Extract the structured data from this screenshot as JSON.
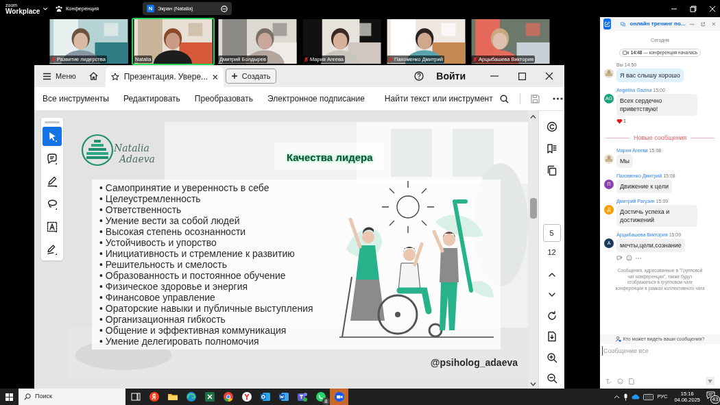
{
  "app_bar": {
    "brand": [
      "zoom",
      "Workplace"
    ],
    "meeting_label": "Конференция",
    "share_pill": {
      "badge": "N",
      "label": "Экран (Natalia)"
    }
  },
  "videos": [
    {
      "name": "Развитие лидерства",
      "muted": true,
      "selected": false
    },
    {
      "name": "Natalia",
      "muted": false,
      "selected": true
    },
    {
      "name": "Дмитрий Болдырев",
      "muted": false,
      "selected": false
    },
    {
      "name": "Мария Агеева",
      "muted": true,
      "selected": false
    },
    {
      "name": "Пахоменко Дмитрий",
      "muted": true,
      "selected": false
    },
    {
      "name": "Арцыбашева Виктория",
      "muted": true,
      "selected": false
    }
  ],
  "viewer": {
    "menu": "Меню",
    "tab_title": "Презентация. Увере...",
    "create": "Создать",
    "sign_in": "Войти",
    "tools": [
      "Все инструменты",
      "Редактировать",
      "Преобразовать",
      "Электронное подписание"
    ],
    "search": "Найти текст или инструмент",
    "left_tools": [
      {
        "kind": "select",
        "selected": true
      },
      {
        "kind": "comment",
        "selected": false
      },
      {
        "kind": "draw",
        "selected": false
      },
      {
        "kind": "lasso",
        "selected": false
      },
      {
        "kind": "textbox",
        "selected": false
      },
      {
        "kind": "sign",
        "selected": false
      }
    ],
    "page": {
      "current": "5",
      "total": "12"
    }
  },
  "slide": {
    "logo": [
      "Natalia",
      "Adaeva"
    ],
    "title": "Качества лидера",
    "items": [
      "• Самопринятие и уверенность в себе",
      "• Целеустремленность",
      "• Ответственность",
      "• Умение вести за собой людей",
      "• Высокая степень осознанности",
      "• Устойчивость и упорство",
      "• Инициативность и стремление к развитию",
      "• Решительность и смелость",
      "• Образованность и постоянное обучение",
      "• Физическое здоровье и энергия",
      "• Финансовое управление",
      "• Ораторские навыки и публичные выступления",
      "• Организационная гибкость",
      "• Общение и эффективная коммуникация",
      "• Умение делегировать полномочия"
    ],
    "handle": "@psiholog_adaeva"
  },
  "chat": {
    "title": "онлайн тренинг по...",
    "day": "Сегодня",
    "event": {
      "time": "14:48",
      "text": "— конференция началась"
    },
    "messages": [
      {
        "kind": "own",
        "header": "Вы 14:50",
        "text": "Я вас слышу хорошо",
        "hovered": false
      },
      {
        "kind": "message",
        "sender": "Angelina Gazina",
        "time": "15:00",
        "initials": "AG",
        "color": "#16a07e",
        "text": "Всех сердечно приветствую!",
        "reaction_count": "1",
        "hovered": false
      },
      {
        "kind": "divider",
        "text": "Новые сообщения"
      },
      {
        "kind": "message",
        "sender": "Мария Агеева",
        "time": "15:08",
        "text": "Мы",
        "hovered": false
      },
      {
        "kind": "message",
        "sender": "Пахоменко Дмитрий",
        "time": "15:08",
        "initials": "П",
        "color": "#8e3fb0",
        "text": "Движение к цели",
        "hovered": false
      },
      {
        "kind": "message",
        "sender": "Дмитрий Рагузин",
        "time": "15:09",
        "initials": "Д",
        "color": "#f4a000",
        "text": "Достичь успеха и достижений",
        "hovered": false
      },
      {
        "kind": "message",
        "sender": "Арцыбашева Виктория",
        "time": "15:09",
        "initials": "A",
        "color": "#1c3a58",
        "text": "мечты,цели,сознание",
        "hovered": true
      }
    ],
    "notice": "Сообщения, адресованные в \"Групповой чат конференции\", также будут отображаться в групповом чате конференции в рамках коллективного чата",
    "who_can_see": "Кто может видеть ваши сообщения?",
    "placeholder": "Сообщение все"
  },
  "taskbar": {
    "search": "Поиск",
    "apps": [
      {
        "kind": "taskview",
        "active": false
      },
      {
        "kind": "yandex",
        "active": false
      },
      {
        "kind": "explorer",
        "active": false
      },
      {
        "kind": "edge",
        "active": false
      },
      {
        "kind": "excel",
        "active": false
      },
      {
        "kind": "chrome",
        "active": false
      },
      {
        "kind": "ybrowser",
        "active": false
      },
      {
        "kind": "outlook",
        "active": false
      },
      {
        "kind": "word",
        "active": false
      },
      {
        "kind": "teams",
        "active": false
      },
      {
        "kind": "whatsapp",
        "active": false,
        "badge": "8"
      },
      {
        "kind": "zoom",
        "active": true
      }
    ],
    "lang": "РУС",
    "time": "15:16",
    "date": "04.06.2025",
    "notifications": "43"
  }
}
